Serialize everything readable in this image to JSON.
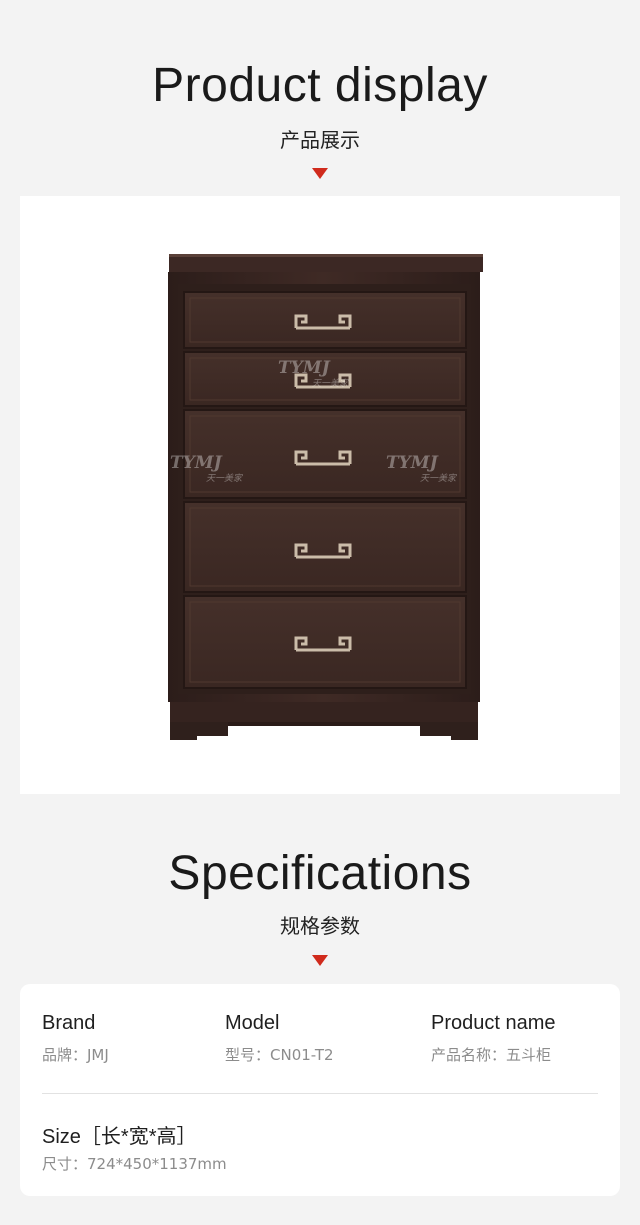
{
  "display": {
    "title": "Product display",
    "subtitle": "产品展示"
  },
  "product_image": {
    "description_icon": "chest-of-drawers",
    "watermark_brand": "TYMJ",
    "watermark_cn": "天一美家",
    "colors": {
      "wood": "#3a2723",
      "handle": "#c9b9a6",
      "arrow": "#d02a1c"
    }
  },
  "specs": {
    "title": "Specifications",
    "subtitle": "规格参数",
    "brand": {
      "label": "Brand",
      "value": "品牌：JMJ"
    },
    "model": {
      "label": "Model",
      "value": "型号：CN01-T2"
    },
    "product_name": {
      "label": "Product name",
      "value": "产品名称：五斗柜"
    },
    "size": {
      "label": "Size［长*宽*高］",
      "value": "尺寸：724*450*1137mm"
    }
  }
}
